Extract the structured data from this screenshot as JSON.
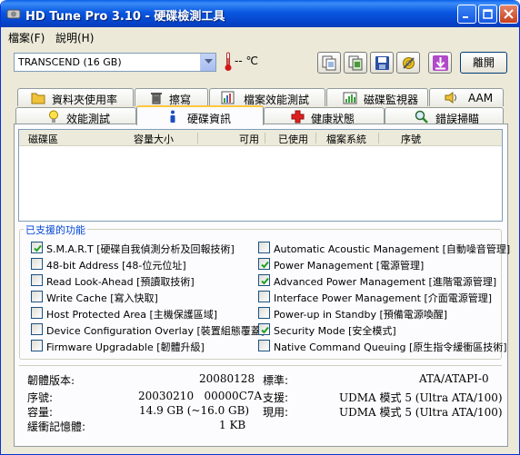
{
  "window": {
    "title": "HD Tune Pro 3.10 - 硬碟檢測工具"
  },
  "menu": [
    "檔案(F)",
    "說明(H)"
  ],
  "toolbar": {
    "drive": "TRANSCEND (16 GB)",
    "temperature": "-- ℃",
    "exit_label": "離開",
    "icons": [
      "copy-text-icon",
      "copy-screenshot-icon",
      "save-icon",
      "options-icon",
      "download-icon"
    ]
  },
  "tabs_row1": [
    {
      "label": "資料夾使用率",
      "icon": "folder-icon"
    },
    {
      "label": "擦寫",
      "icon": "trash-icon"
    },
    {
      "label": "檔案效能測試",
      "icon": "file-benchmark-icon"
    },
    {
      "label": "磁碟監視器",
      "icon": "monitor-chart-icon"
    },
    {
      "label": "AAM",
      "icon": "speaker-icon"
    }
  ],
  "tabs_row2": [
    {
      "label": "效能測試",
      "icon": "lightbulb-icon"
    },
    {
      "label": "硬碟資訊",
      "icon": "info-icon",
      "active": true
    },
    {
      "label": "健康狀態",
      "icon": "health-cross-icon"
    },
    {
      "label": "錯誤掃瞄",
      "icon": "magnifier-icon"
    }
  ],
  "partition_table": {
    "columns": [
      "磁碟區",
      "容量大小",
      "可用",
      "已使用",
      "檔案系統",
      "序號"
    ],
    "rows": []
  },
  "features": {
    "legend": "已支援的功能",
    "left": [
      {
        "label": "S.M.A.R.T [硬碟自我偵測分析及回報技術]",
        "checked": true
      },
      {
        "label": "48-bit Address [48-位元位址]",
        "checked": false
      },
      {
        "label": "Read Look-Ahead [預讀取技術]",
        "checked": false
      },
      {
        "label": "Write Cache [寫入快取]",
        "checked": false
      },
      {
        "label": "Host Protected Area [主機保護區域]",
        "checked": false
      },
      {
        "label": "Device Configuration Overlay [裝置組態覆蓋]",
        "checked": false
      },
      {
        "label": "Firmware Upgradable [韌體升級]",
        "checked": false
      }
    ],
    "right": [
      {
        "label": "Automatic Acoustic Management [自動噪音管理]",
        "checked": false
      },
      {
        "label": "Power Management [電源管理]",
        "checked": true
      },
      {
        "label": "Advanced Power Management [進階電源管理]",
        "checked": true
      },
      {
        "label": "Interface Power Management [介面電源管理]",
        "checked": false
      },
      {
        "label": "Power-up in Standby [預備電源喚醒]",
        "checked": false
      },
      {
        "label": "Security Mode [安全模式]",
        "checked": true
      },
      {
        "label": "Native Command Queuing [原生指令緩衝區技術]",
        "checked": false
      }
    ]
  },
  "info": {
    "firmware_label": "韌體版本:",
    "firmware": "20080128",
    "serial_label": "序號:",
    "serial": "20030210   00000C7A",
    "capacity_label": "容量:",
    "capacity": "14.9 GB (~16.0 GB)",
    "buffer_label": "緩衝記憶體:",
    "buffer": "1 KB",
    "standard_label": "標準:",
    "standard": "ATA/ATAPI-0",
    "supported_label": "支援:",
    "supported": "UDMA 模式 5 (Ultra ATA/100)",
    "active_label": "現用:",
    "active": "UDMA 模式 5 (Ultra ATA/100)"
  },
  "colors": {
    "title_bar": "#0a58e0",
    "face": "#ece9d8",
    "legend": "#0046d5",
    "active_tab_accent": "#ffc73c"
  }
}
